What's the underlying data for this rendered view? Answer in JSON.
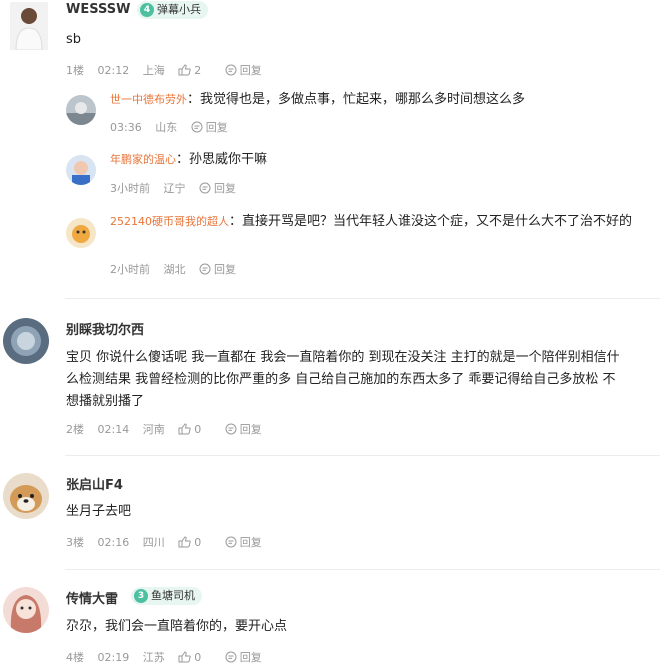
{
  "comments": [
    {
      "username": "WESSSW",
      "badge": {
        "num": "4",
        "label": "弹幕小兵"
      },
      "text": "sb",
      "floor": "1楼",
      "time": "02:12",
      "location": "上海",
      "likes": "2",
      "reply_label": "回复",
      "replies": [
        {
          "name": "世一中德布劳外",
          "sep": "：",
          "text": "我觉得也是，多做点事，忙起来，哪那么多时间想这么多",
          "time": "03:36",
          "location": "山东",
          "reply_label": "回复"
        },
        {
          "name": "年鹏家的温心",
          "sep": "：",
          "text": "孙思威你干嘛",
          "time": "3小时前",
          "location": "辽宁",
          "reply_label": "回复"
        },
        {
          "name": "252140硬币哥我的超人",
          "sep": "：",
          "text": "直接开骂是吧？当代年轻人谁没这个症，又不是什么大不了治不好的",
          "time": "2小时前",
          "location": "湖北",
          "reply_label": "回复"
        }
      ]
    },
    {
      "username": "别睬我切尔西",
      "text": "宝贝 你说什么傻话呢 我一直都在 我会一直陪着你的 到现在没关注 主打的就是一个陪伴别相信什么检测结果 我曾经检测的比你严重的多 自己给自己施加的东西太多了 乖要记得给自己多放松 不想播就别播了",
      "floor": "2楼",
      "time": "02:14",
      "location": "河南",
      "likes": "0",
      "reply_label": "回复"
    },
    {
      "username": "张启山F4",
      "text": "坐月子去吧",
      "floor": "3楼",
      "time": "02:16",
      "location": "四川",
      "likes": "0",
      "reply_label": "回复"
    },
    {
      "username": "传情大雷",
      "badge": {
        "num": "3",
        "label": "鱼塘司机"
      },
      "text": "尕尕，我们会一直陪着你的，要开心点",
      "floor": "4楼",
      "time": "02:19",
      "location": "江苏",
      "likes": "0",
      "reply_label": "回复"
    }
  ],
  "colors": {
    "reply_name": "#e8753a",
    "badge_bg": "#e8f6f1",
    "badge_icon": "#4cc0a0",
    "meta": "#999999"
  }
}
